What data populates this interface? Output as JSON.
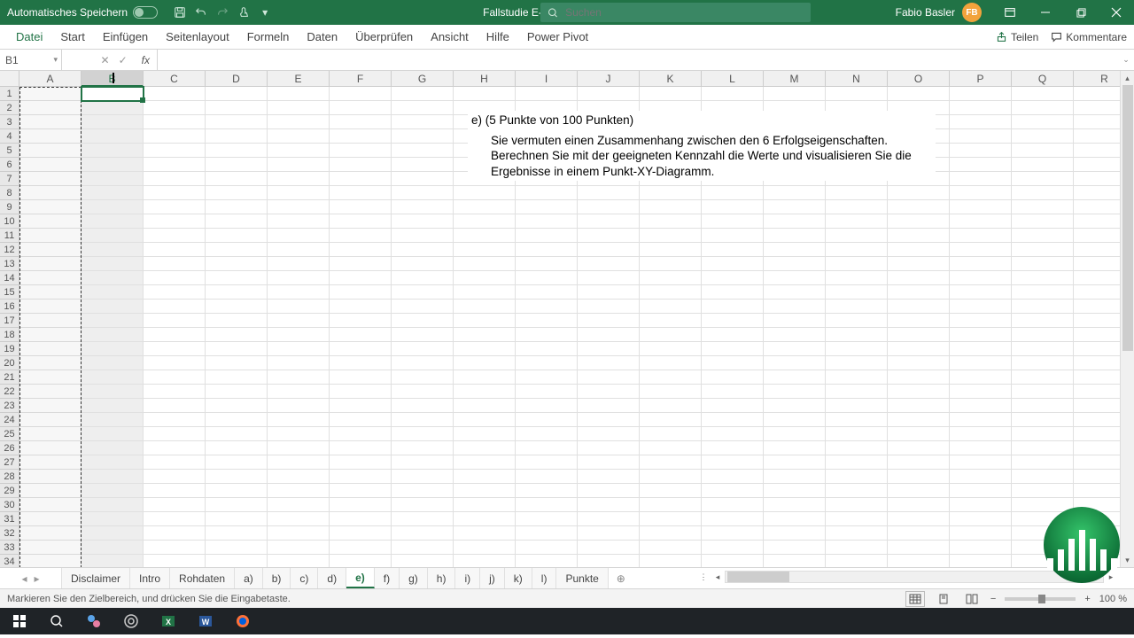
{
  "titlebar": {
    "autosave": "Automatisches Speichern",
    "doc_title": "Fallstudie E-Commerce Webshop",
    "search_placeholder": "Suchen",
    "user_name": "Fabio Basler",
    "user_initials": "FB"
  },
  "ribbon": {
    "tabs": [
      "Datei",
      "Start",
      "Einfügen",
      "Seitenlayout",
      "Formeln",
      "Daten",
      "Überprüfen",
      "Ansicht",
      "Hilfe",
      "Power Pivot"
    ],
    "share": "Teilen",
    "comments": "Kommentare"
  },
  "formula": {
    "name_box": "B1",
    "value": ""
  },
  "columns": [
    "A",
    "B",
    "C",
    "D",
    "E",
    "F",
    "G",
    "H",
    "I",
    "J",
    "K",
    "L",
    "M",
    "N",
    "O",
    "P",
    "Q",
    "R"
  ],
  "row_count": 34,
  "selected_column_index": 1,
  "question": {
    "heading": "e) (5 Punkte von 100 Punkten)",
    "body": "Sie vermuten einen Zusammenhang zwischen den 6 Erfolgseigenschaften. Berechnen Sie mit der geeigneten Kennzahl die Werte und visualisieren Sie die Ergebnisse in einem Punkt-XY-Diagramm."
  },
  "sheets": [
    "Disclaimer",
    "Intro",
    "Rohdaten",
    "a)",
    "b)",
    "c)",
    "d)",
    "e)",
    "f)",
    "g)",
    "h)",
    "i)",
    "j)",
    "k)",
    "l)",
    "Punkte"
  ],
  "active_sheet": "e)",
  "status": {
    "text": "Markieren Sie den Zielbereich, und drücken Sie die Eingabetaste.",
    "zoom": "100 %"
  }
}
